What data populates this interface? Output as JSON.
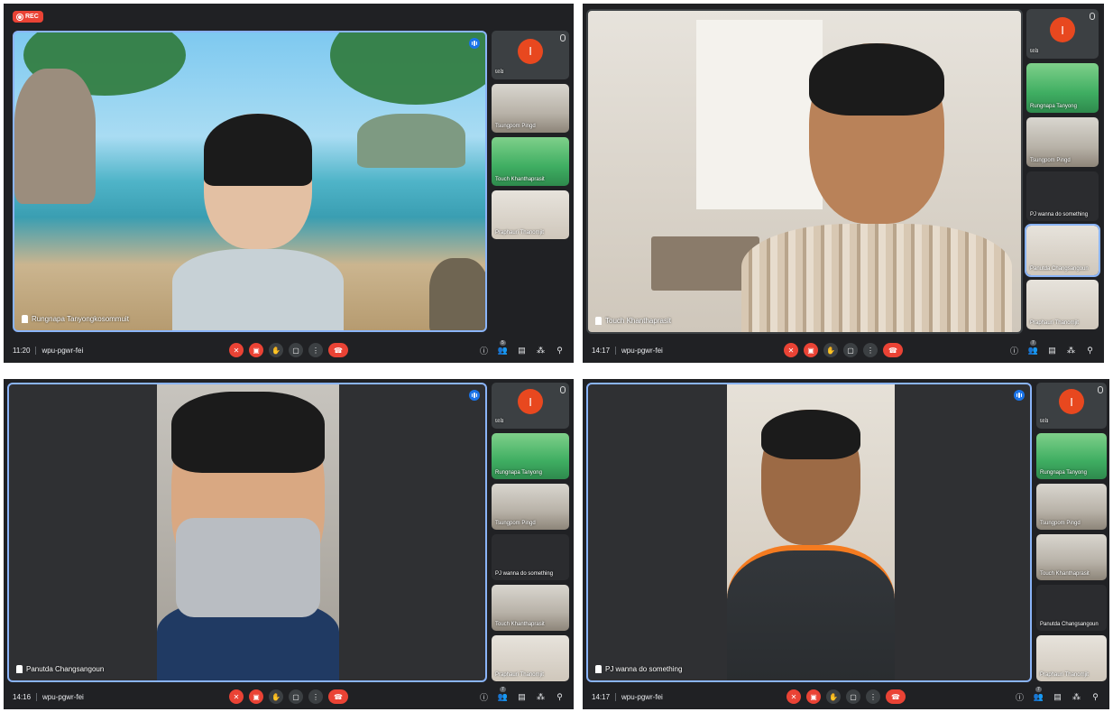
{
  "panels": [
    {
      "rec_label": "REC",
      "main_name": "Rungnapa Tanyongkosommuit",
      "time": "11:20",
      "meeting_code": "wpu-pgwr-fei",
      "side": [
        {
          "name": "ខេង",
          "type": "avatar",
          "initial": "I"
        },
        {
          "name": "Tsungpom Pingd",
          "type": "office"
        },
        {
          "name": "Touch Khanthaprasit",
          "type": "green"
        },
        {
          "name": "Praphauri Thanomjit",
          "type": "room"
        }
      ],
      "people_count": "5"
    },
    {
      "main_name": "Touch Khanthaprasit",
      "time": "14:17",
      "meeting_code": "wpu-pgwr-fei",
      "side": [
        {
          "name": "ខេង",
          "type": "avatar",
          "initial": "I"
        },
        {
          "name": "Rungnapa Tanyong",
          "type": "green"
        },
        {
          "name": "Tsungpom Pingd",
          "type": "office"
        },
        {
          "name": "PJ wanna do something",
          "type": "dark"
        },
        {
          "name": "Panutda Changsangoun",
          "type": "room",
          "active": true
        },
        {
          "name": "Praphauri Thanomjit",
          "type": "room"
        }
      ],
      "people_count": "7"
    },
    {
      "main_name": "Panutda Changsangoun",
      "time": "14:16",
      "meeting_code": "wpu-pgwr-fei",
      "side": [
        {
          "name": "ខេង",
          "type": "avatar",
          "initial": "I"
        },
        {
          "name": "Rungnapa Tanyong",
          "type": "green"
        },
        {
          "name": "Tsungpom Pingd",
          "type": "office"
        },
        {
          "name": "PJ wanna do something",
          "type": "dark"
        },
        {
          "name": "Touch Khanthaprasit",
          "type": "office"
        },
        {
          "name": "Praphauri Thanomjit",
          "type": "room"
        }
      ],
      "people_count": "7"
    },
    {
      "main_name": "PJ wanna do something",
      "time": "14:17",
      "meeting_code": "wpu-pgwr-fei",
      "side": [
        {
          "name": "ខេង",
          "type": "avatar",
          "initial": "I"
        },
        {
          "name": "Rungnapa Tanyong",
          "type": "green"
        },
        {
          "name": "Tsungpom Pingd",
          "type": "office"
        },
        {
          "name": "Touch Khanthaprasit",
          "type": "office"
        },
        {
          "name": "Panutda Changsangoun",
          "type": "room"
        },
        {
          "name": "Praphauri Thanomjit",
          "type": "room"
        }
      ],
      "people_count": "7"
    }
  ]
}
